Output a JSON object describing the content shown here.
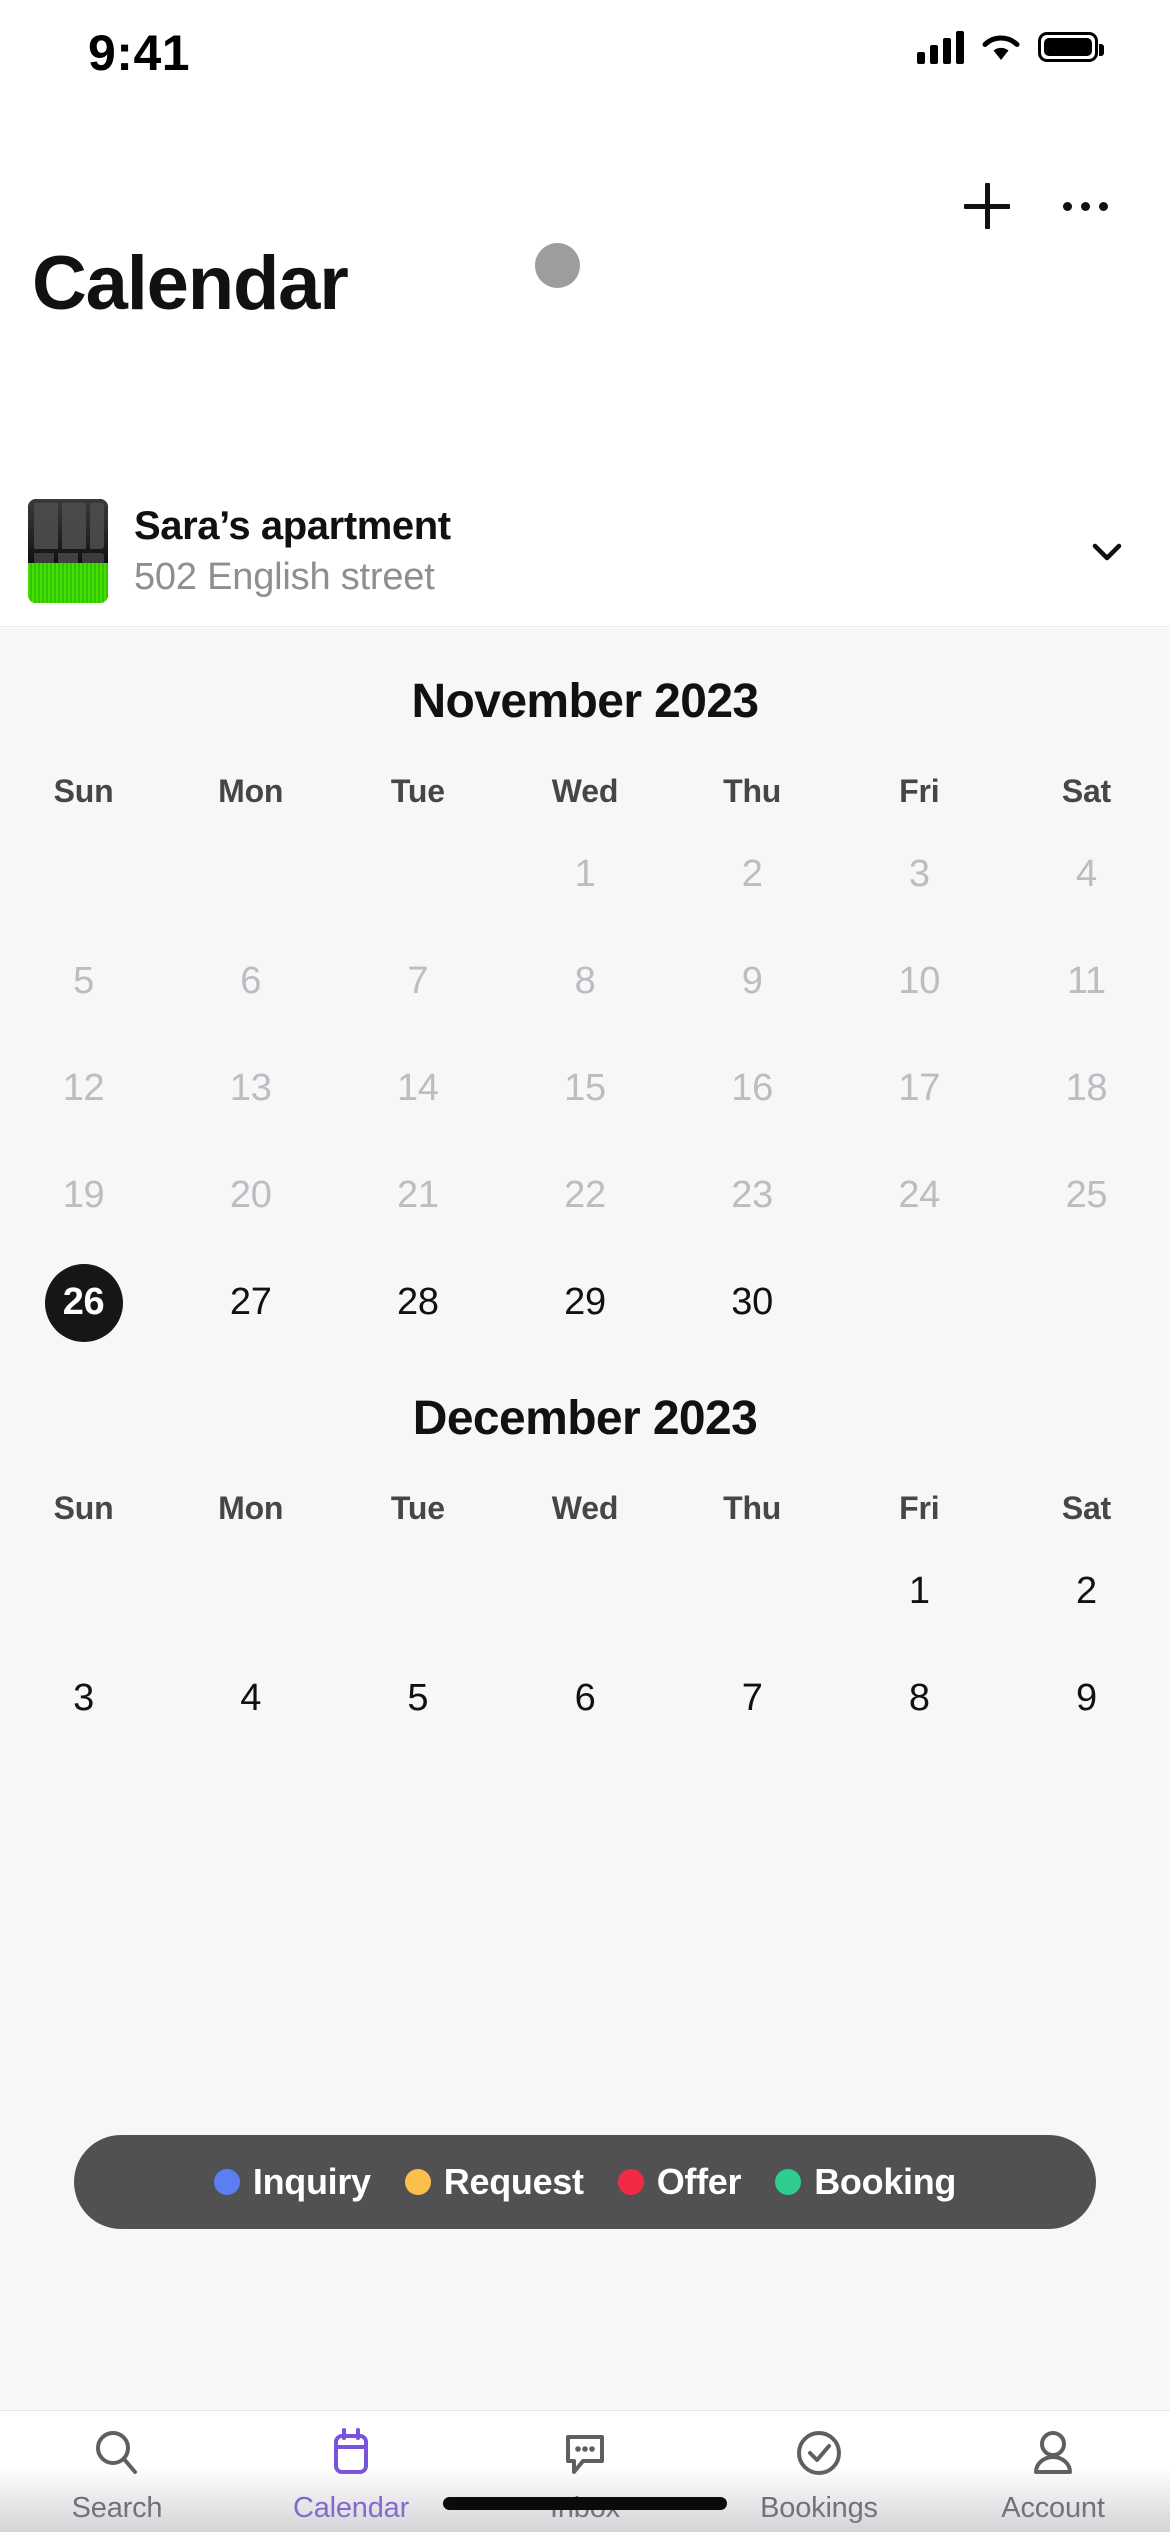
{
  "status_bar": {
    "time": "9:41",
    "signal_icon": "cellular-bars-icon",
    "wifi_icon": "wifi-icon",
    "battery_icon": "battery-full-icon"
  },
  "header": {
    "title": "Calendar",
    "add_icon": "plus-icon",
    "more_icon": "ellipsis-icon",
    "avatar_icon": "avatar-dot"
  },
  "property": {
    "name": "Sara’s apartment",
    "address": "502 English street",
    "thumbnail_icon": "property-thumbnail",
    "expand_icon": "chevron-down-icon"
  },
  "calendar": {
    "weekdays": [
      "Sun",
      "Mon",
      "Tue",
      "Wed",
      "Thu",
      "Fri",
      "Sat"
    ],
    "selected_date": "26",
    "months": [
      {
        "title": "November 2023",
        "weeks": [
          [
            {
              "label": "",
              "state": "empty"
            },
            {
              "label": "",
              "state": "empty"
            },
            {
              "label": "",
              "state": "empty"
            },
            {
              "label": "1",
              "state": "muted"
            },
            {
              "label": "2",
              "state": "muted"
            },
            {
              "label": "3",
              "state": "muted"
            },
            {
              "label": "4",
              "state": "muted"
            }
          ],
          [
            {
              "label": "5",
              "state": "muted"
            },
            {
              "label": "6",
              "state": "muted"
            },
            {
              "label": "7",
              "state": "muted"
            },
            {
              "label": "8",
              "state": "muted"
            },
            {
              "label": "9",
              "state": "muted"
            },
            {
              "label": "10",
              "state": "muted"
            },
            {
              "label": "11",
              "state": "muted"
            }
          ],
          [
            {
              "label": "12",
              "state": "muted"
            },
            {
              "label": "13",
              "state": "muted"
            },
            {
              "label": "14",
              "state": "muted"
            },
            {
              "label": "15",
              "state": "muted"
            },
            {
              "label": "16",
              "state": "muted"
            },
            {
              "label": "17",
              "state": "muted"
            },
            {
              "label": "18",
              "state": "muted"
            }
          ],
          [
            {
              "label": "19",
              "state": "muted"
            },
            {
              "label": "20",
              "state": "muted"
            },
            {
              "label": "21",
              "state": "muted"
            },
            {
              "label": "22",
              "state": "muted"
            },
            {
              "label": "23",
              "state": "muted"
            },
            {
              "label": "24",
              "state": "muted"
            },
            {
              "label": "25",
              "state": "muted"
            }
          ],
          [
            {
              "label": "26",
              "state": "selected"
            },
            {
              "label": "27",
              "state": "active"
            },
            {
              "label": "28",
              "state": "active"
            },
            {
              "label": "29",
              "state": "active"
            },
            {
              "label": "30",
              "state": "active"
            },
            {
              "label": "",
              "state": "empty"
            },
            {
              "label": "",
              "state": "empty"
            }
          ]
        ]
      },
      {
        "title": "December 2023",
        "weeks": [
          [
            {
              "label": "",
              "state": "empty"
            },
            {
              "label": "",
              "state": "empty"
            },
            {
              "label": "",
              "state": "empty"
            },
            {
              "label": "",
              "state": "empty"
            },
            {
              "label": "",
              "state": "empty"
            },
            {
              "label": "1",
              "state": "active"
            },
            {
              "label": "2",
              "state": "active"
            }
          ],
          [
            {
              "label": "3",
              "state": "active"
            },
            {
              "label": "4",
              "state": "active"
            },
            {
              "label": "5",
              "state": "active"
            },
            {
              "label": "6",
              "state": "active"
            },
            {
              "label": "7",
              "state": "active"
            },
            {
              "label": "8",
              "state": "active"
            },
            {
              "label": "9",
              "state": "active"
            }
          ]
        ]
      }
    ]
  },
  "legend": {
    "items": [
      {
        "label": "Inquiry",
        "color": "#5b7ff0"
      },
      {
        "label": "Request",
        "color": "#fbc04a"
      },
      {
        "label": "Offer",
        "color": "#f22b45"
      },
      {
        "label": "Booking",
        "color": "#2ecc8f"
      }
    ]
  },
  "tabbar": {
    "active_color": "#7b52e0",
    "items": [
      {
        "label": "Search",
        "icon": "search-icon",
        "active": false
      },
      {
        "label": "Calendar",
        "icon": "calendar-icon",
        "active": true
      },
      {
        "label": "Inbox",
        "icon": "chat-bubble-icon",
        "active": false
      },
      {
        "label": "Bookings",
        "icon": "check-circle-icon",
        "active": false
      },
      {
        "label": "Account",
        "icon": "person-icon",
        "active": false
      }
    ]
  }
}
